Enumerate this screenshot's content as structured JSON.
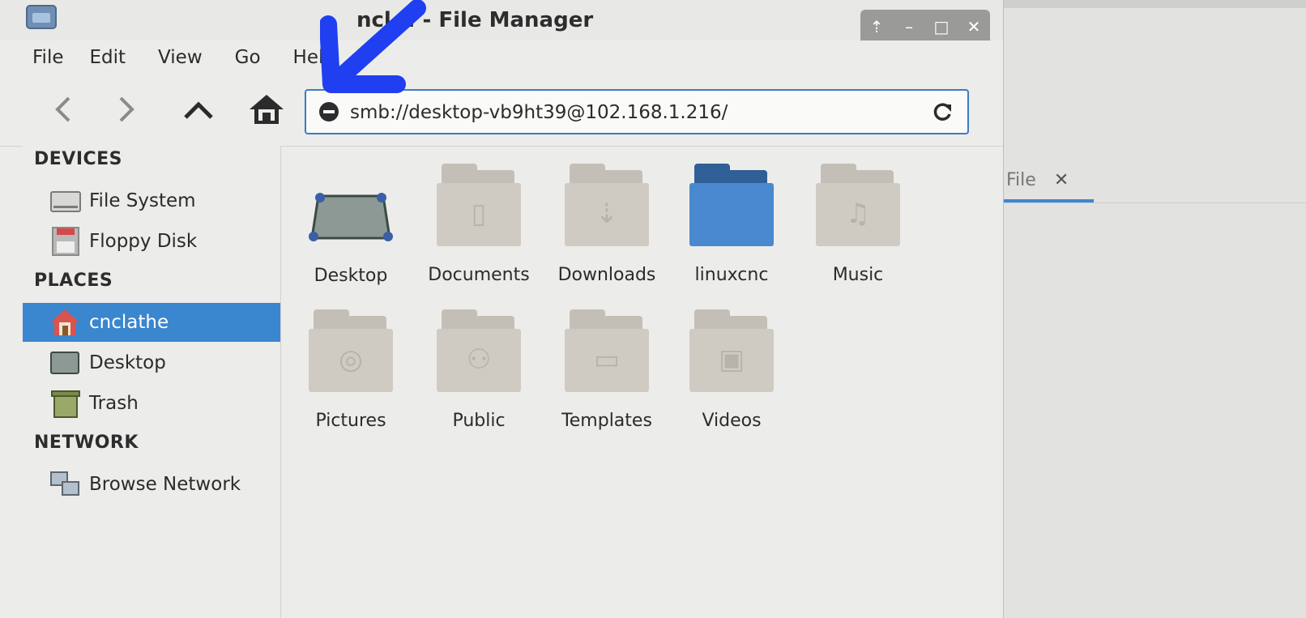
{
  "window": {
    "title": "ncl... - File Manager",
    "title_buttons": [
      "⇡",
      "–",
      "□",
      "✕"
    ]
  },
  "menubar": {
    "items": [
      "File",
      "Edit",
      "View",
      "Go",
      "Hel"
    ]
  },
  "toolbar": {
    "address_value": "smb://desktop-vb9ht39@102.168.1.216/"
  },
  "sidebar": {
    "devices_label": "DEVICES",
    "places_label": "PLACES",
    "network_label": "NETWORK",
    "devices": [
      {
        "label": "File System",
        "icon": "drive-icon"
      },
      {
        "label": "Floppy Disk",
        "icon": "floppy-icon"
      }
    ],
    "places": [
      {
        "label": "cnclathe",
        "icon": "home-icon",
        "active": true
      },
      {
        "label": "Desktop",
        "icon": "desktop-icon"
      },
      {
        "label": "Trash",
        "icon": "trash-icon"
      }
    ],
    "network": [
      {
        "label": "Browse Network",
        "icon": "network-icon"
      }
    ]
  },
  "files": [
    {
      "name": "Desktop",
      "icon": "desktop-icon"
    },
    {
      "name": "Documents",
      "icon": "folder-documents-icon"
    },
    {
      "name": "Downloads",
      "icon": "folder-downloads-icon"
    },
    {
      "name": "linuxcnc",
      "icon": "folder-blue-icon"
    },
    {
      "name": "Music",
      "icon": "folder-music-icon"
    },
    {
      "name": "Pictures",
      "icon": "folder-pictures-icon"
    },
    {
      "name": "Public",
      "icon": "folder-public-icon"
    },
    {
      "name": "Templates",
      "icon": "folder-templates-icon"
    },
    {
      "name": "Videos",
      "icon": "folder-videos-icon"
    }
  ],
  "background_window": {
    "tab_label": "File",
    "tab_close": "✕"
  },
  "colors": {
    "accent": "#3a86cf",
    "annotation": "#1f3ff0"
  }
}
